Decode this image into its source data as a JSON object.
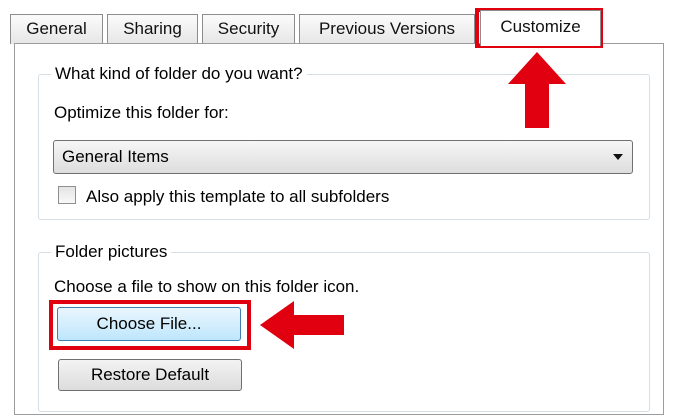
{
  "tabs": [
    {
      "label": "General"
    },
    {
      "label": "Sharing"
    },
    {
      "label": "Security"
    },
    {
      "label": "Previous Versions"
    },
    {
      "label": "Customize",
      "active": true
    }
  ],
  "folder_type_group": {
    "legend": "What kind of folder do you want?",
    "optimize_label": "Optimize this folder for:",
    "combo_value": "General Items",
    "apply_checkbox_label": "Also apply this template to all subfolders",
    "apply_checkbox_checked": false
  },
  "folder_pictures_group": {
    "legend": "Folder pictures",
    "description": "Choose a file to show on this folder icon.",
    "choose_file_button": "Choose File...",
    "restore_default_button": "Restore Default"
  },
  "colors": {
    "highlight_red": "#e1000f"
  }
}
